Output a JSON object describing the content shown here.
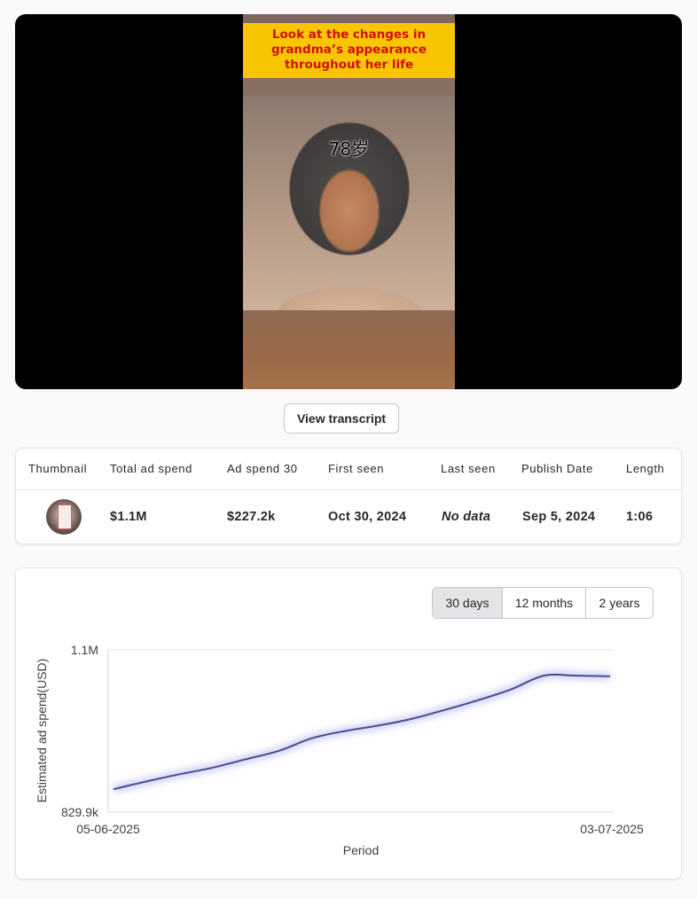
{
  "video": {
    "caption": "Look at the changes in grandma’s appearance throughout her life",
    "age_label": "78岁"
  },
  "transcript_button": "View transcript",
  "info_table": {
    "headers": [
      "Thumbnail",
      "Total ad spend",
      "Ad spend 30",
      "First seen",
      "Last seen",
      "Publish Date",
      "Length"
    ],
    "row": {
      "total_ad_spend": "$1.1M",
      "ad_spend_30": "$227.2k",
      "first_seen": "Oct 30, 2024",
      "last_seen": "No data",
      "publish_date": "Sep 5, 2024",
      "length": "1:06"
    }
  },
  "range_selector": {
    "options": [
      "30 days",
      "12 months",
      "2 years"
    ],
    "selected": "30 days"
  },
  "chart_data": {
    "type": "line",
    "title": "",
    "xlabel": "Period",
    "ylabel": "Estimated ad spend(USD)",
    "x_ticks": [
      "05-06-2025",
      "03-07-2025"
    ],
    "y_ticks": [
      "1.1M",
      "829.9k"
    ],
    "ylim": [
      829900,
      1100000
    ],
    "grid": "horizontal",
    "line_color": "#4a4c93",
    "series": [
      {
        "x": [
          "05-06-2025",
          "07-06-2025",
          "09-06-2025",
          "11-06-2025",
          "13-06-2025",
          "15-06-2025",
          "17-06-2025",
          "19-06-2025",
          "21-06-2025",
          "23-06-2025",
          "25-06-2025",
          "27-06-2025",
          "29-06-2025",
          "01-07-2025",
          "02-07-2025",
          "03-07-2025"
        ],
        "values": [
          868000,
          881000,
          893000,
          904000,
          918000,
          932000,
          953000,
          965000,
          974000,
          985000,
          1000000,
          1016000,
          1034000,
          1057000,
          1057000,
          1056000
        ]
      }
    ]
  }
}
